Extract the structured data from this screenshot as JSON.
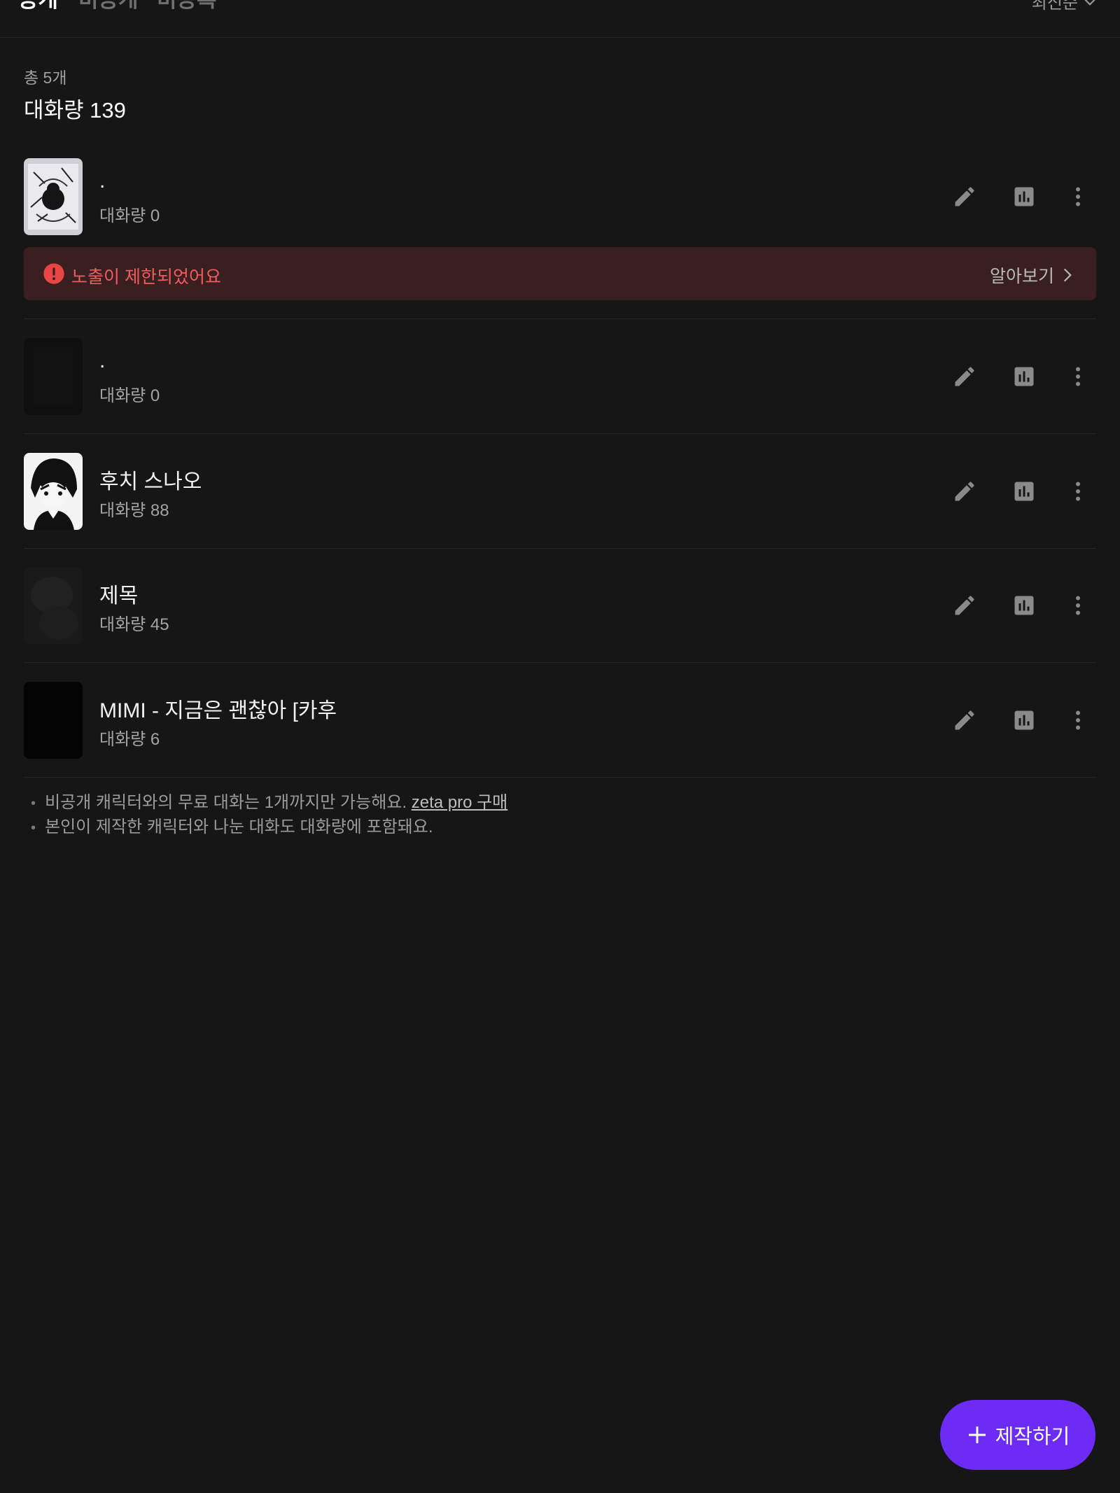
{
  "tabs": [
    {
      "label": "공개",
      "active": true
    },
    {
      "label": "비공개",
      "active": false
    },
    {
      "label": "비등록",
      "active": false
    }
  ],
  "sort": {
    "label": "최신순"
  },
  "summary": {
    "count_label": "총 5개",
    "total_label": "대화량 139"
  },
  "characters": [
    {
      "title": ".",
      "sub": "대화량 0"
    },
    {
      "title": ".",
      "sub": "대화량 0"
    },
    {
      "title": "후치 스나오",
      "sub": "대화량 88"
    },
    {
      "title": "제목",
      "sub": "대화량 45"
    },
    {
      "title": "MIMI - 지금은 괜찮아 [카후",
      "sub": "대화량 6"
    }
  ],
  "warning": {
    "text": "노출이 제한되었어요",
    "link_label": "알아보기",
    "color": "#f15b5b"
  },
  "notes": {
    "line1": "비공개 캐릭터와의 무료 대화는 1개까지만 가능해요.",
    "line1_link": "zeta pro 구매",
    "line2": "본인이 제작한 캐릭터와 나눈 대화도 대화량에 포함돼요."
  },
  "fab": {
    "label": "제작하기",
    "color": "#6c2cf6"
  },
  "icons": {
    "edit": "pencil-icon",
    "stats": "bar-chart-icon",
    "more": "more-vertical-icon",
    "sort": "chevron-down-icon",
    "warning": "alert-circle-icon",
    "link": "chevron-right-icon",
    "add": "plus-icon"
  }
}
